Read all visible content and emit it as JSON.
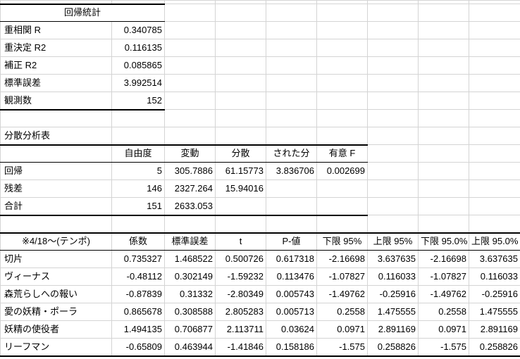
{
  "sheet": {
    "regression_stats": {
      "title": "回帰統計",
      "rows": [
        {
          "label": "重相関 R",
          "value": "0.340785"
        },
        {
          "label": "重決定 R2",
          "value": "0.116135"
        },
        {
          "label": "補正 R2",
          "value": "0.085865"
        },
        {
          "label": "標準誤差",
          "value": "3.992514"
        },
        {
          "label": "観測数",
          "value": "152"
        }
      ]
    },
    "anova": {
      "title": "分散分析表",
      "headers": {
        "df": "自由度",
        "ss": "変動",
        "ms": "分散",
        "f": "された分",
        "sig_f": "有意 F"
      },
      "rows": [
        {
          "label": "回帰",
          "df": "5",
          "ss": "305.7886",
          "ms": "61.15773",
          "f": "3.836706",
          "sig_f": "0.002699"
        },
        {
          "label": "残差",
          "df": "146",
          "ss": "2327.264",
          "ms": "15.94016"
        },
        {
          "label": "合計",
          "df": "151",
          "ss": "2633.053"
        }
      ]
    },
    "coefficients": {
      "headers": [
        "※4/18～(テンポ)",
        "係数",
        "標準誤差",
        "t",
        "P-値",
        "下限 95%",
        "上限 95%",
        "下限 95.0%",
        "上限 95.0%"
      ],
      "rows": [
        [
          "切片",
          "0.735327",
          "1.468522",
          "0.500726",
          "0.617318",
          "-2.16698",
          "3.637635",
          "-2.16698",
          "3.637635"
        ],
        [
          "ヴィーナス",
          "-0.48112",
          "0.302149",
          "-1.59232",
          "0.113476",
          "-1.07827",
          "0.116033",
          "-1.07827",
          "0.116033"
        ],
        [
          "森荒らしへの報い",
          "-0.87839",
          "0.31332",
          "-2.80349",
          "0.005743",
          "-1.49762",
          "-0.25916",
          "-1.49762",
          "-0.25916"
        ],
        [
          "愛の妖精・ポーラ",
          "0.865678",
          "0.308588",
          "2.805283",
          "0.005713",
          "0.2558",
          "1.475555",
          "0.2558",
          "1.475555"
        ],
        [
          "妖精の使役者",
          "1.494135",
          "0.706877",
          "2.113711",
          "0.03624",
          "0.0971",
          "2.891169",
          "0.0971",
          "2.891169"
        ],
        [
          "リーフマン",
          "-0.65809",
          "0.463944",
          "-1.41846",
          "0.158186",
          "-1.575",
          "0.258826",
          "-1.575",
          "0.258826"
        ]
      ]
    }
  }
}
